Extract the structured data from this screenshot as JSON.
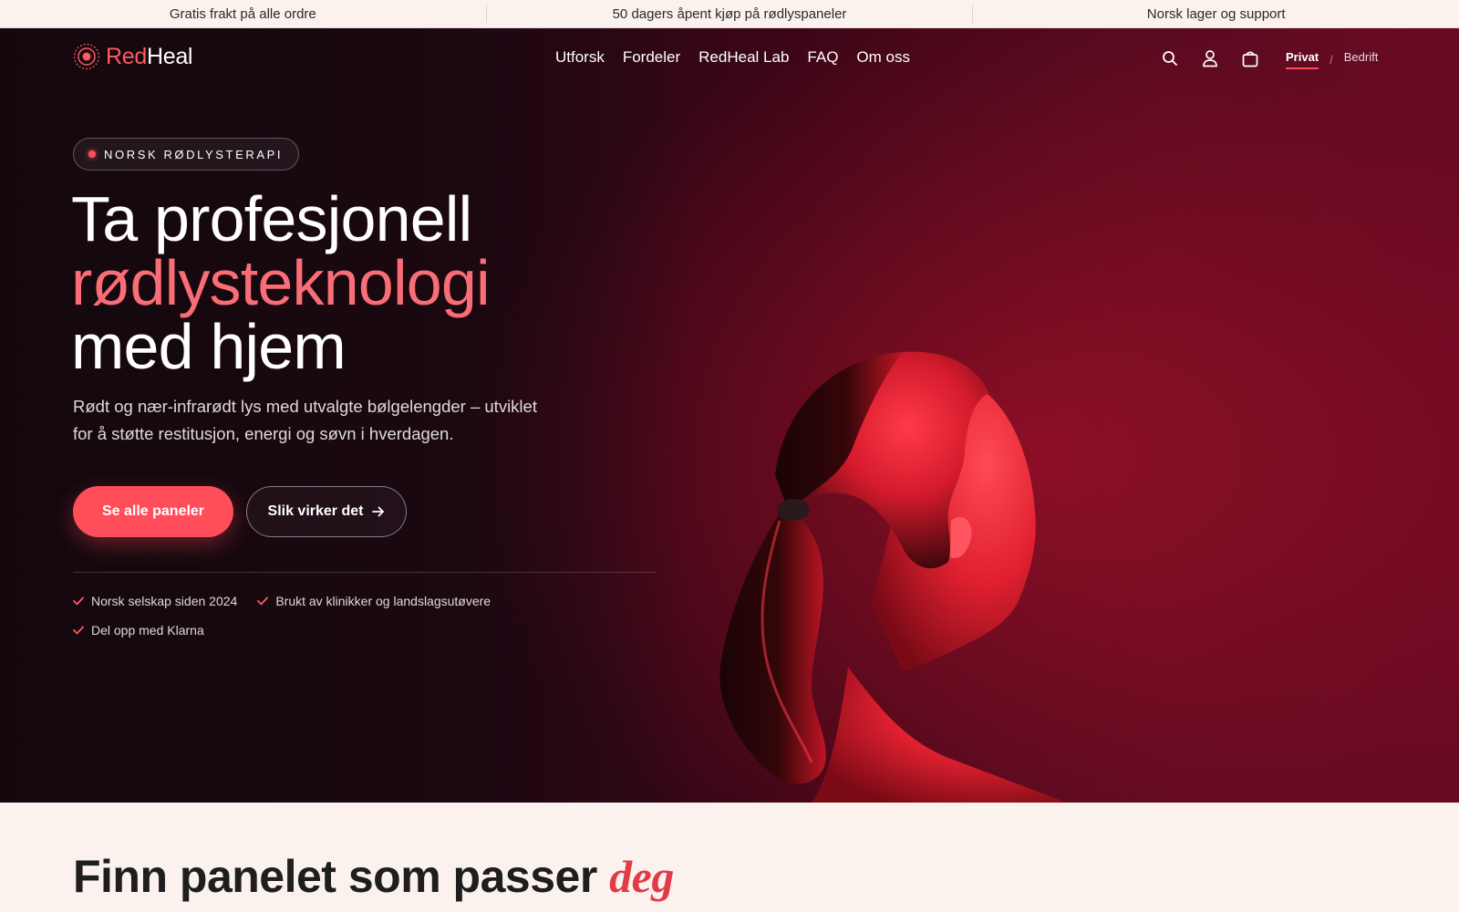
{
  "announcements": [
    {
      "text": "Gratis frakt på alle ordre"
    },
    {
      "text": "50 dagers åpent kjøp på rødlyspaneler"
    },
    {
      "text": "Norsk lager og support"
    }
  ],
  "brand": {
    "part1": "Red",
    "part2": "Heal",
    "accent_color": "#ff5a64"
  },
  "nav": {
    "items": [
      {
        "label": "Utforsk"
      },
      {
        "label": "Fordeler"
      },
      {
        "label": "RedHeal Lab"
      },
      {
        "label": "FAQ"
      },
      {
        "label": "Om oss"
      }
    ],
    "icons": [
      "search-icon",
      "account-icon",
      "cart-icon"
    ],
    "segment": {
      "active": "Privat",
      "separator": "/",
      "inactive": "Bedrift"
    }
  },
  "hero": {
    "badge": "NORSK RØDLYSTERAPI",
    "headline_line1": "Ta profesjonell",
    "headline_line2": "rødlysteknologi",
    "headline_line3": "med hjem",
    "lead": "Rødt og nær-infrarødt lys med utvalgte bølgelengder – utviklet for å støtte restitusjon, energi og søvn i hverdagen.",
    "primary_cta": "Se alle paneler",
    "secondary_cta": "Slik virker det",
    "checks": [
      {
        "text": "Norsk selskap siden 2024"
      },
      {
        "text": "Brukt av klinikker og landslagsutøvere"
      },
      {
        "text": "Del opp med Klarna"
      }
    ]
  },
  "section": {
    "title_main": "Finn panelet som passer ",
    "title_emphasis": "deg"
  },
  "colors": {
    "accent": "#ff4d5a",
    "hero_dark": "#170810",
    "hero_red": "#6a0a22",
    "page_bg": "#fbf2ee"
  }
}
